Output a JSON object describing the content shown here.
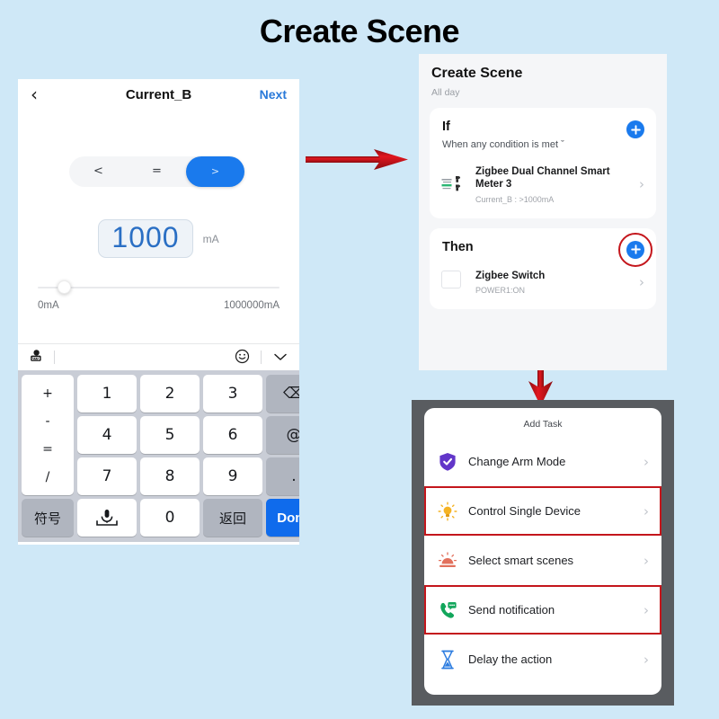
{
  "page": {
    "title": "Create Scene"
  },
  "colors": {
    "background": "#cfe8f7",
    "accent_blue": "#1a7aed",
    "highlight_red": "#c4161c",
    "panel_frame": "#595c60"
  },
  "left_phone": {
    "navbar": {
      "back_icon": "chevron-left-icon",
      "title": "Current_B",
      "next_label": "Next"
    },
    "segments": [
      {
        "label": "<",
        "active": false
      },
      {
        "label": "=",
        "active": false
      },
      {
        "label": ">",
        "active": true
      }
    ],
    "value": {
      "text": "1000",
      "unit": "mA"
    },
    "slider": {
      "min_label": "0mA",
      "max_label": "1000000mA",
      "knob_position_pct": 8
    },
    "keyboard": {
      "toolbar": {
        "left_icon": "globe-keyboard-icon",
        "emoji_icon": "smiley-icon",
        "collapse_icon": "chevron-down-icon"
      },
      "ops_keys": [
        "+",
        "-",
        "=",
        "/"
      ],
      "number_keys": [
        "1",
        "2",
        "3",
        "4",
        "5",
        "6",
        "7",
        "8",
        "9",
        "0"
      ],
      "backspace_label": "⌫",
      "at_label": "@",
      "dot_label": ".",
      "symbol_label": "符号",
      "mic_label": "mic-space-icon",
      "return_label": "返回",
      "done_label": "Done"
    }
  },
  "panel_top_right": {
    "title": "Create Scene",
    "subtitle": "All day",
    "if_card": {
      "heading": "If",
      "condition_text": "When any condition is met",
      "condition_caret": "ˇ",
      "add_button_icon": "plus-circle-icon",
      "add_button_highlighted": false,
      "device": {
        "icon": "energy-meter-icon",
        "name": "Zigbee Dual Channel Smart Meter 3",
        "detail": "Current_B : >1000mA",
        "chevron": "›"
      }
    },
    "then_card": {
      "heading": "Then",
      "add_button_icon": "plus-circle-icon",
      "add_button_highlighted": true,
      "device": {
        "icon": "switch-icon",
        "name": "Zigbee Switch",
        "detail": "POWER1:ON",
        "chevron": "›"
      }
    }
  },
  "panel_bottom_right": {
    "sheet_title": "Add Task",
    "tasks": [
      {
        "label": "Change Arm Mode",
        "icon": "shield-check-icon",
        "icon_color": "#6236c9",
        "highlighted": false,
        "chevron": "›"
      },
      {
        "label": "Control Single Device",
        "icon": "bulb-icon",
        "icon_color": "#f5b324",
        "highlighted": true,
        "chevron": "›"
      },
      {
        "label": "Select smart scenes",
        "icon": "sunrise-scene-icon",
        "icon_color": "#e2705c",
        "highlighted": false,
        "chevron": "›"
      },
      {
        "label": "Send notification",
        "icon": "phone-message-icon",
        "icon_color": "#12a65b",
        "highlighted": true,
        "chevron": "›"
      },
      {
        "label": "Delay the action",
        "icon": "hourglass-icon",
        "icon_color": "#2d7de0",
        "highlighted": false,
        "chevron": "›"
      }
    ]
  },
  "arrows": [
    {
      "name": "arrow-left-to-top-right",
      "direction": "right"
    },
    {
      "name": "arrow-top-right-to-bottom-right",
      "direction": "down"
    }
  ]
}
